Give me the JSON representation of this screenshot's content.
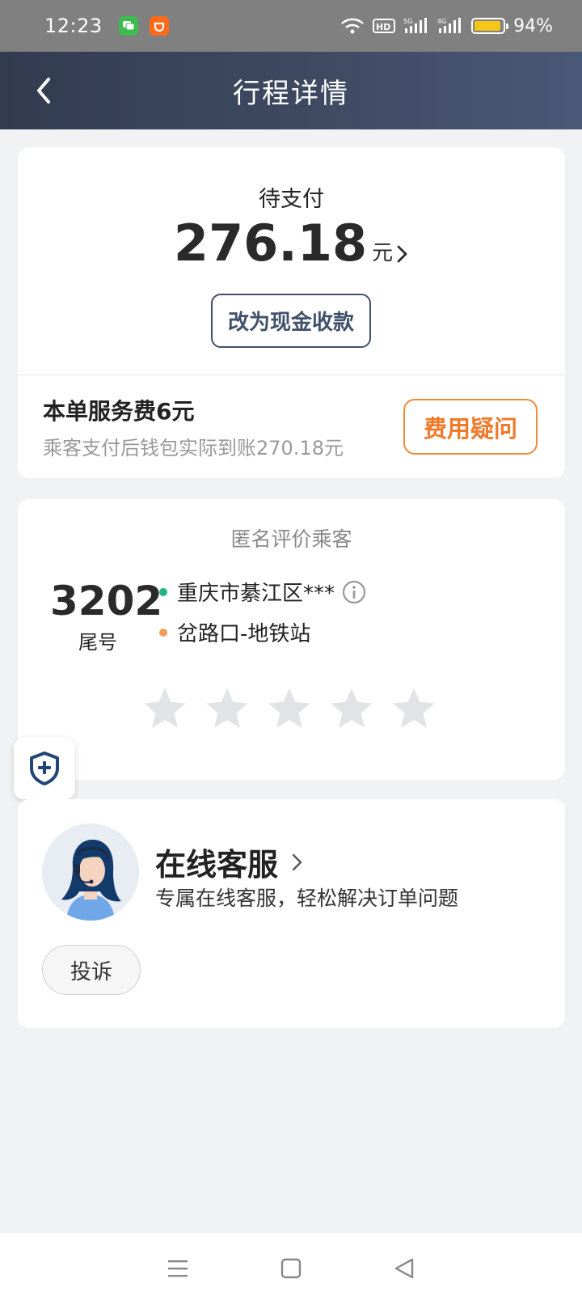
{
  "status": {
    "time": "12:23",
    "battery": "94%",
    "battery_level": 0.94
  },
  "header": {
    "title": "行程详情"
  },
  "payment": {
    "status_label": "待支付",
    "amount": "276.18",
    "unit": "元",
    "cash_button": "改为现金收款",
    "fee_title": "本单服务费6元",
    "fee_subtitle": "乘客支付后钱包实际到账270.18元",
    "fee_question_button": "费用疑问"
  },
  "rating": {
    "title": "匿名评价乘客",
    "tail_number": "3202",
    "tail_label": "尾号",
    "origin": "重庆市綦江区***",
    "destination": "岔路口-地铁站",
    "stars": [
      1,
      2,
      3,
      4,
      5
    ]
  },
  "support": {
    "title": "在线客服",
    "subtitle": "专属在线客服，轻松解决订单问题",
    "complain_button": "投诉"
  },
  "colors": {
    "header_bg": "#3f4a62",
    "accent_orange": "#f07a2a",
    "button_navy": "#41506b",
    "origin_dot": "#1fb589",
    "dest_dot": "#f39c58"
  }
}
